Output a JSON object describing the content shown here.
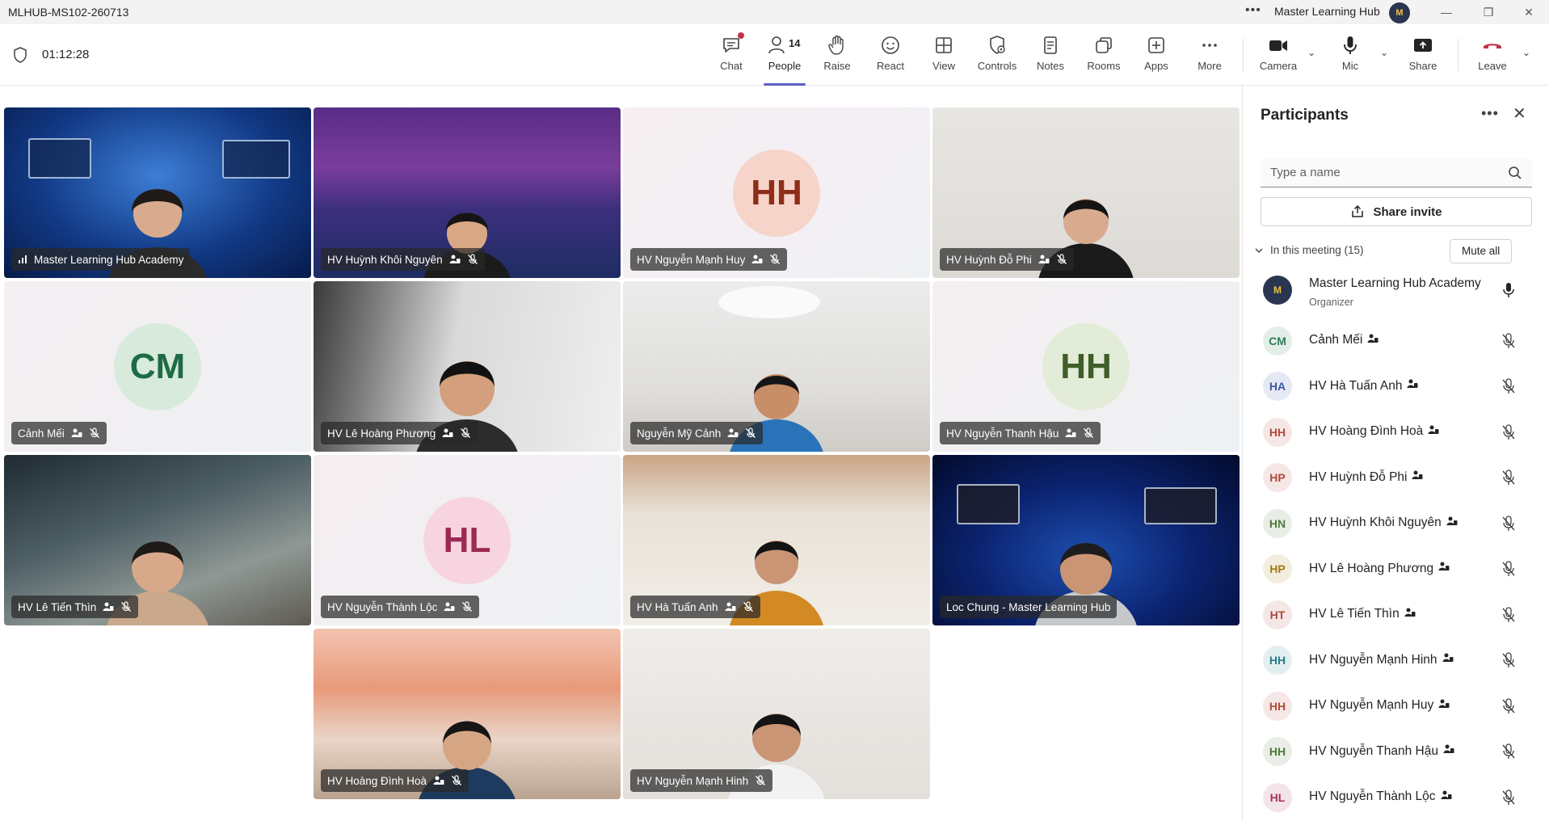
{
  "window": {
    "title": "MLHUB-MS102-260713",
    "org_name": "Master Learning Hub",
    "avatar_text": "M"
  },
  "toolbar": {
    "timer": "01:12:28",
    "people_count": "14",
    "buttons": {
      "chat": "Chat",
      "people": "People",
      "raise": "Raise",
      "react": "React",
      "view": "View",
      "controls": "Controls",
      "notes": "Notes",
      "rooms": "Rooms",
      "apps": "Apps",
      "more": "More",
      "camera": "Camera",
      "mic": "Mic",
      "share": "Share",
      "leave": "Leave"
    }
  },
  "tiles": [
    {
      "name": "Master Learning Hub Academy",
      "type": "video",
      "icon": "signal-bars-icon"
    },
    {
      "name": "HV Huỳnh Khôi Nguyên",
      "type": "video"
    },
    {
      "name": "HV Nguyễn Mạnh Huy",
      "type": "initials",
      "initials": "HH"
    },
    {
      "name": "HV Huỳnh Đỗ Phi",
      "type": "video"
    },
    {
      "name": "Cảnh Mếi",
      "type": "initials",
      "initials": "CM"
    },
    {
      "name": "HV Lê Hoàng Phương",
      "type": "video"
    },
    {
      "name": "Nguyễn Mỹ Cảnh",
      "type": "video"
    },
    {
      "name": "HV Nguyễn Thanh Hậu",
      "type": "initials",
      "initials": "HH"
    },
    {
      "name": "HV Lê Tiến Thìn",
      "type": "video"
    },
    {
      "name": "HV Nguyễn Thành Lộc",
      "type": "initials",
      "initials": "HL"
    },
    {
      "name": "HV Hà Tuấn Anh",
      "type": "video"
    },
    {
      "name": "Loc Chung - Master Learning Hub",
      "type": "video",
      "speaking": true
    },
    {
      "name": "HV Hoàng Đình Hoà",
      "type": "video"
    },
    {
      "name": "HV Nguyễn Mạnh Hinh",
      "type": "video"
    }
  ],
  "panel": {
    "title": "Participants",
    "search_placeholder": "Type a name",
    "share_invite": "Share invite",
    "section": "In this meeting (15)",
    "mute_all": "Mute all",
    "participants": [
      {
        "initials": "M",
        "name": "Master Learning Hub Academy",
        "role": "Organizer",
        "color": "#2a3550"
      },
      {
        "initials": "CM",
        "name": "Cảnh Mếi",
        "color": "#2e7d5b"
      },
      {
        "initials": "HA",
        "name": "HV Hà Tuấn Anh",
        "color": "#3b5aa3"
      },
      {
        "initials": "HH",
        "name": "HV Hoàng Đình Hoà",
        "color": "#b14a3a"
      },
      {
        "initials": "HP",
        "name": "HV Huỳnh Đỗ Phi",
        "color": "#b14a3a"
      },
      {
        "initials": "HN",
        "name": "HV Huỳnh Khôi Nguyên",
        "color": "#4f7a3a"
      },
      {
        "initials": "HP",
        "name": "HV Lê Hoàng Phương",
        "color": "#a27a12"
      },
      {
        "initials": "HT",
        "name": "HV Lê Tiến Thìn",
        "color": "#b14a3a"
      },
      {
        "initials": "HH",
        "name": "HV Nguyễn Mạnh Hinh",
        "color": "#2a7c8c"
      },
      {
        "initials": "HH",
        "name": "HV Nguyễn Mạnh Huy",
        "color": "#b14a3a"
      },
      {
        "initials": "HH",
        "name": "HV Nguyễn Thanh Hậu",
        "color": "#4f7a3a"
      },
      {
        "initials": "HL",
        "name": "HV Nguyễn Thành Lộc",
        "color": "#a8325e"
      }
    ]
  }
}
